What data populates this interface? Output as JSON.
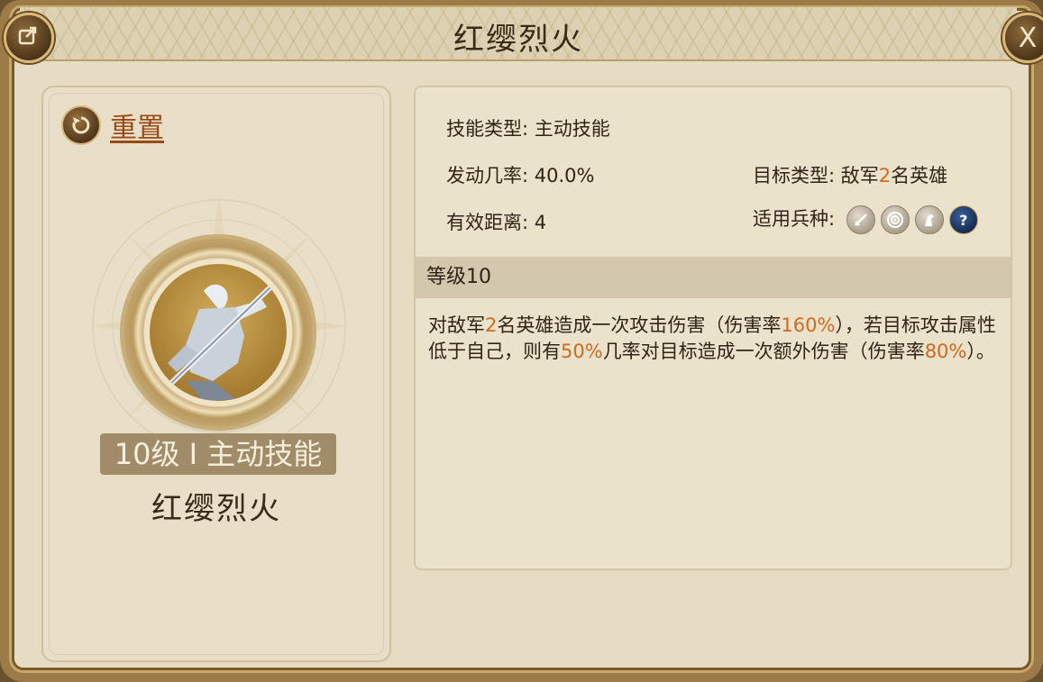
{
  "title": "红缨烈火",
  "buttons": {
    "share_icon": "share-icon",
    "close_label": "X"
  },
  "left": {
    "reset_label": "重置",
    "level_badge": "10级 I 主动技能",
    "skill_name": "红缨烈火"
  },
  "info": {
    "skill_type_label": "技能类型:",
    "skill_type_value": "主动技能",
    "rate_label": "发动几率:",
    "rate_value": "40.0%",
    "target_label": "目标类型:",
    "target_pre": "敌军",
    "target_num": "2",
    "target_post": "名英雄",
    "range_label": "有效距离:",
    "range_value": "4",
    "units_label": "适用兵种:",
    "unit_icons": [
      "sword-icon",
      "target-icon",
      "horse-icon",
      "question-icon"
    ]
  },
  "level": {
    "label": "等级10"
  },
  "description": {
    "p1": "对敌军",
    "n1": "2",
    "p2": "名英雄造成一次攻击伤害（伤害率",
    "n2": "160%",
    "p3": "），若目标攻击属性低于自己，则有",
    "n3": "50%",
    "p4": "几率对目标造成一次额外伤害（伤害率",
    "n4": "80%",
    "p5": "）。"
  },
  "colors": {
    "accent": "#d2691e",
    "reset": "#9b4a15",
    "badge": "#a08c68"
  }
}
